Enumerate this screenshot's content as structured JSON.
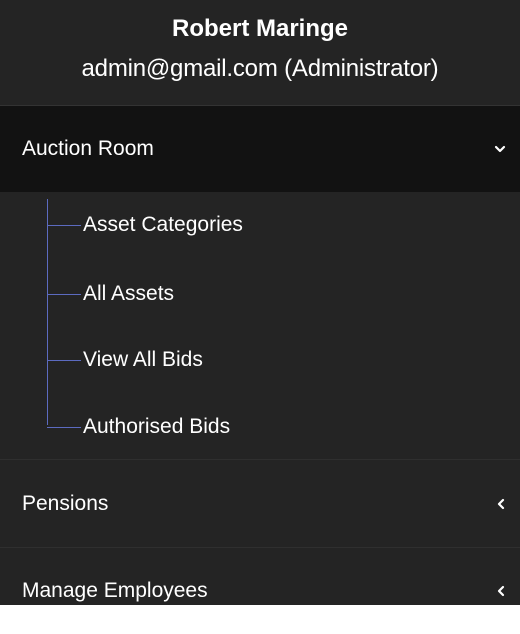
{
  "user": {
    "name": "Robert Maringe",
    "email_role": "admin@gmail.com (Administrator)"
  },
  "menu": {
    "auction_room": {
      "label": "Auction Room",
      "icon": "chevron-down-icon",
      "expanded": true,
      "items": [
        {
          "label": "Asset Categories"
        },
        {
          "label": "All Assets"
        },
        {
          "label": "View All Bids"
        },
        {
          "label": "Authorised Bids"
        }
      ]
    },
    "pensions": {
      "label": "Pensions",
      "icon": "chevron-left-icon"
    },
    "manage_employees": {
      "label": "Manage Employees",
      "icon": "chevron-left-icon"
    }
  },
  "colors": {
    "sidebar_bg": "#242424",
    "active_bg": "#121212",
    "tree_line": "#5c6bc0",
    "text": "#ffffff"
  }
}
